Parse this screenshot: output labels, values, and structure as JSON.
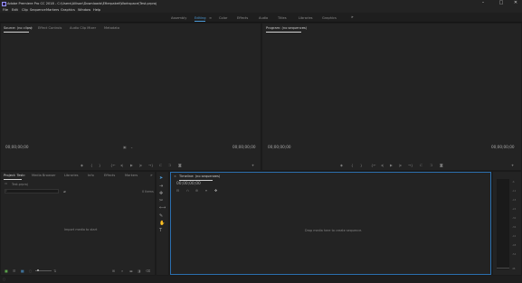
{
  "window": {
    "title": "Adobe Premiere Pro CC 2018 - C:\\Users\\Allison\\Downloads\\Efterpaket\\Workspace\\Test.prproj",
    "controls": [
      "–",
      "□",
      "✕"
    ]
  },
  "menu": [
    "File",
    "Edit",
    "Clip",
    "Sequence",
    "Markers",
    "Graphics",
    "Window",
    "Help"
  ],
  "workspaces": {
    "items": [
      "Assembly",
      "Editing",
      "Color",
      "Effects",
      "Audio",
      "Titles",
      "Libraries",
      "Graphics"
    ],
    "active": "Editing",
    "menu_icon": "≡",
    "more_icon": "»"
  },
  "source_monitor": {
    "tabs": [
      "Source: (no clips)",
      "Effect Controls",
      "Audio Clip Mixer",
      "Metadata"
    ],
    "active_tab": "Source: (no clips)",
    "timecode_left": "00;00;00;00",
    "timecode_right": "00;00;00;00"
  },
  "program_monitor": {
    "tab": "Program: (no sequences)",
    "timecode_left": "00;00;00;00",
    "timecode_right": "00;00;00;00"
  },
  "project_panel": {
    "tabs": [
      "Project: Test",
      "Media Browser",
      "Libraries",
      "Info",
      "Effects",
      "Markers"
    ],
    "active_tab": "Project: Test",
    "more": "»",
    "project_file": "Test.prproj",
    "item_count": "0 Items",
    "empty_hint": "Import media to start"
  },
  "timeline": {
    "tab": "Timeline: (no sequences)",
    "timecode": "00;00;00;00",
    "empty_hint": "Drop media here to create sequence."
  },
  "audio_meter": {
    "ticks": [
      "-6",
      "-12",
      "-18",
      "-24",
      "-30",
      "-36",
      "-42",
      "-48",
      "-54",
      "dB"
    ]
  },
  "colors": {
    "accent": "#4d9bd8",
    "timeline_border": "#2b6fae",
    "panel_bg": "#232323",
    "app_bg": "#1b1b1b"
  }
}
